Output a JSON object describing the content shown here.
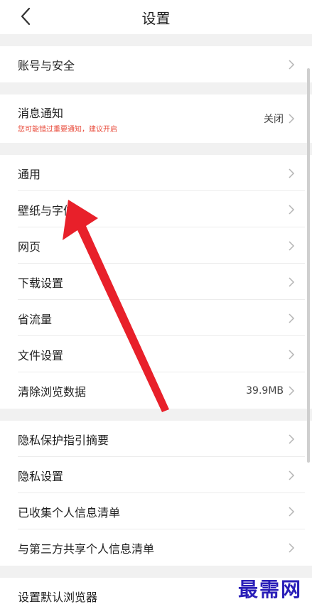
{
  "header": {
    "title": "设置",
    "back_icon": "chevron-left-icon"
  },
  "groups": [
    {
      "items": [
        {
          "label": "账号与安全"
        }
      ]
    },
    {
      "items": [
        {
          "label": "消息通知",
          "sub": "您可能错过重要通知，建议开启",
          "value": "关闭"
        }
      ]
    },
    {
      "items": [
        {
          "label": "通用"
        },
        {
          "label": "壁纸与字体"
        },
        {
          "label": "网页"
        },
        {
          "label": "下载设置"
        },
        {
          "label": "省流量"
        },
        {
          "label": "文件设置"
        },
        {
          "label": "清除浏览数据",
          "value": "39.9MB"
        }
      ]
    },
    {
      "items": [
        {
          "label": "隐私保护指引摘要"
        },
        {
          "label": "隐私设置"
        },
        {
          "label": "已收集个人信息清单"
        },
        {
          "label": "与第三方共享个人信息清单"
        }
      ]
    },
    {
      "items": [
        {
          "label": "设置默认浏览器"
        }
      ]
    }
  ],
  "watermark": "最需网",
  "colors": {
    "accent_red": "#e8202a",
    "sub_text": "#e84a3a",
    "watermark": "#2a1fb8"
  }
}
